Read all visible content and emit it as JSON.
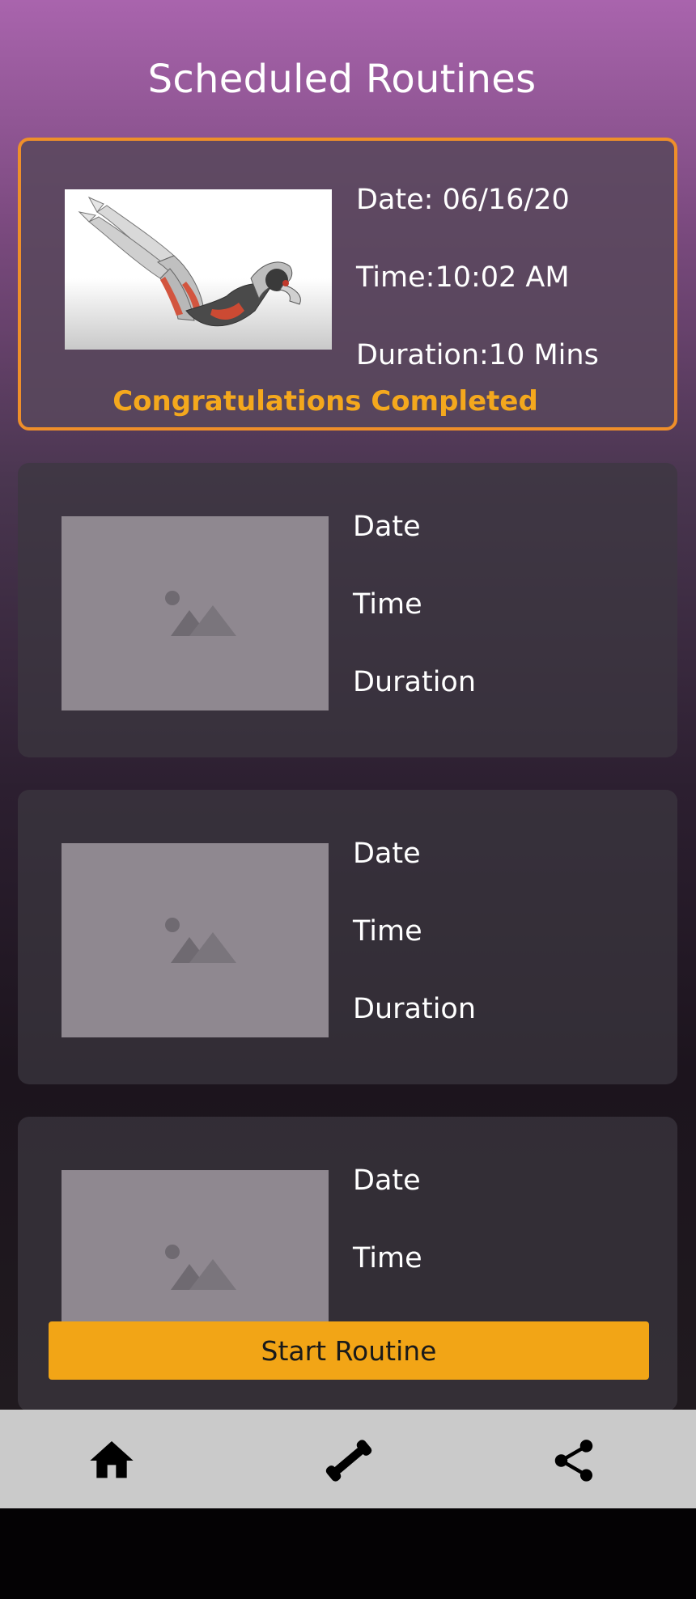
{
  "screen": {
    "title": "Scheduled Routines"
  },
  "routines": [
    {
      "date": "Date: 06/16/20",
      "time": "Time:10:02 AM",
      "duration": "Duration:10 Mins",
      "status": "Congratulations Completed",
      "image": "crunch-exercise-illustration"
    },
    {
      "date": "Date",
      "time": "Time",
      "duration": "Duration",
      "image": "image-placeholder-icon"
    },
    {
      "date": "Date",
      "time": "Time",
      "duration": "Duration",
      "image": "image-placeholder-icon"
    },
    {
      "date": "Date",
      "time": "Time",
      "image": "image-placeholder-icon"
    }
  ],
  "actions": {
    "start_label": "Start Routine"
  },
  "bottom_nav": [
    {
      "icon": "home-icon"
    },
    {
      "icon": "dumbbell-icon"
    },
    {
      "icon": "share-icon"
    }
  ],
  "colors": {
    "accent": "#f2a516",
    "completed_border": "#ef8f2a",
    "completed_text": "#f4a81d",
    "nav_bg": "#cacaca"
  }
}
